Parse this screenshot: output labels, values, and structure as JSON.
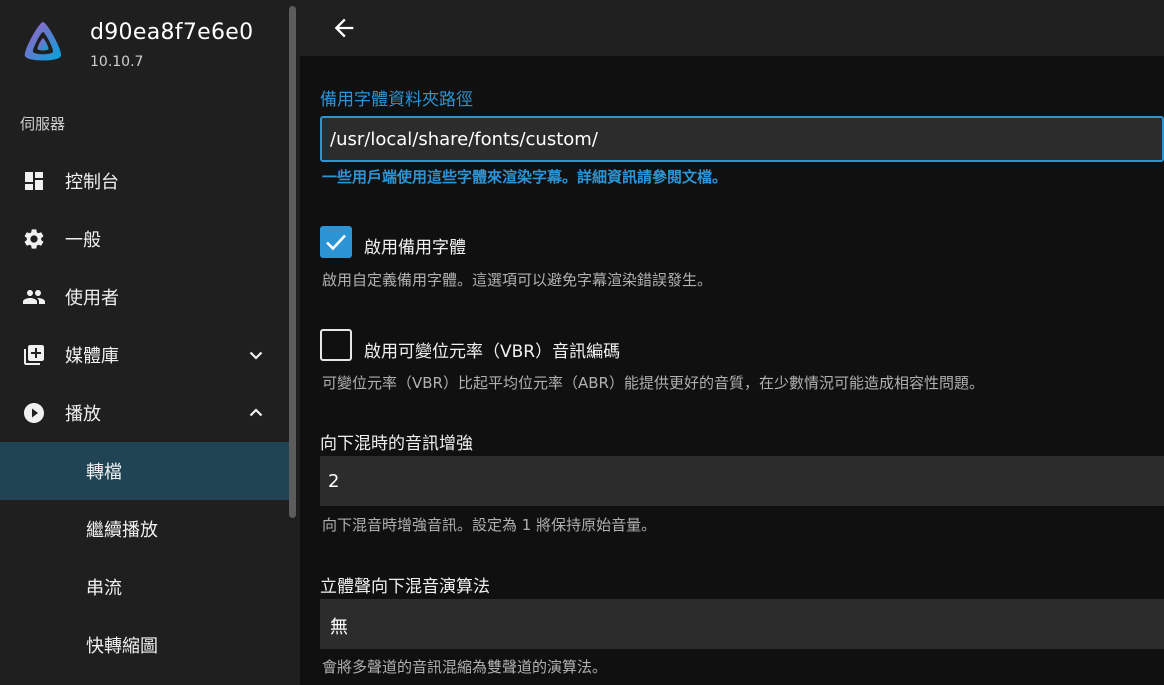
{
  "sidebar": {
    "server_name": "d90ea8f7e6e0",
    "server_version": "10.10.7",
    "section_label": "伺服器",
    "items": [
      {
        "label": "控制台",
        "icon": "dashboard-icon"
      },
      {
        "label": "一般",
        "icon": "gear-icon"
      },
      {
        "label": "使用者",
        "icon": "people-icon"
      },
      {
        "label": "媒體庫",
        "icon": "library-add-icon",
        "expanded": false
      },
      {
        "label": "播放",
        "icon": "play-circle-icon",
        "expanded": true
      }
    ],
    "sub_items": [
      {
        "label": "轉檔",
        "active": true
      },
      {
        "label": "繼續播放"
      },
      {
        "label": "串流"
      },
      {
        "label": "快轉縮圖"
      }
    ]
  },
  "topbar": {
    "back_icon": "arrow-left-icon"
  },
  "form": {
    "fallback_font_path": {
      "label": "備用字體資料夾路徑",
      "value": "/usr/local/share/fonts/custom/",
      "help": "一些用戶端使用這些字體來渲染字幕。詳細資訊請參閱文檔。"
    },
    "enable_fallback_font": {
      "label": "啟用備用字體",
      "checked": true,
      "help": "啟用自定義備用字體。這選項可以避免字幕渲染錯誤發生。"
    },
    "enable_vbr_audio": {
      "label": "啟用可變位元率（VBR）音訊編碼",
      "checked": false,
      "help": "可變位元率（VBR）比起平均位元率（ABR）能提供更好的音質，在少數情況可能造成相容性問題。"
    },
    "downmix_boost": {
      "label": "向下混時的音訊增強",
      "value": "2",
      "help": "向下混音時增強音訊。設定為 1 將保持原始音量。"
    },
    "stereo_downmix_algorithm": {
      "label": "立體聲向下混音演算法",
      "value": "無",
      "help": "會將多聲道的音訊混縮為雙聲道的演算法。"
    }
  },
  "colors": {
    "accent": "#2c94d4",
    "sidebar_bg": "#1f1f1f",
    "active_item_bg": "#214455",
    "page_bg": "#101010"
  }
}
